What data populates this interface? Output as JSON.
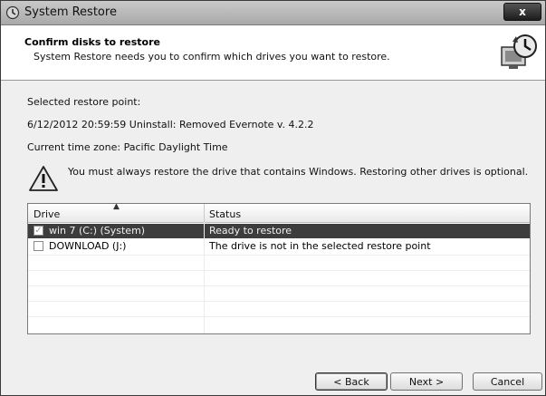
{
  "window": {
    "title": "System Restore",
    "close_label": "x"
  },
  "header": {
    "title": "Confirm disks to restore",
    "subtitle": "System Restore needs you to confirm which drives you want to restore."
  },
  "info": {
    "restore_point_label": "Selected restore point:",
    "restore_point_value": "6/12/2012 20:59:59 Uninstall: Removed Evernote v. 4.2.2",
    "timezone": "Current time zone: Pacific Daylight Time"
  },
  "warning": {
    "text": "You must always restore the drive that contains Windows. Restoring other drives is optional."
  },
  "drives_table": {
    "columns": [
      "Drive",
      "Status"
    ],
    "rows": [
      {
        "drive": "win 7 (C:) (System)",
        "status": "Ready to restore",
        "checked": true,
        "selected": true
      },
      {
        "drive": "DOWNLOAD (J:)",
        "status": "The drive is not in the selected restore point",
        "checked": false,
        "selected": false
      }
    ]
  },
  "buttons": {
    "back": "< Back",
    "next": "Next >",
    "cancel": "Cancel"
  }
}
